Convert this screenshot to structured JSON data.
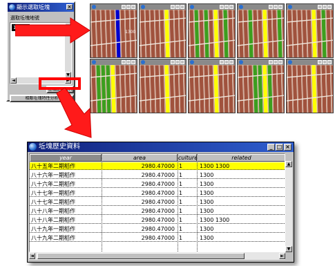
{
  "small_window": {
    "title": "顯示選取坵塊",
    "label": "選取坵塊地號",
    "selected_item": "1300",
    "history_button": "坵塊歷史資料",
    "advanced_button": "相鄰坵塊特性分析"
  },
  "map_grid": {
    "selected_parcel_label": "1300",
    "colors": {
      "paddy": "#a0523d",
      "fallow": "#3c9e1e",
      "selected": "#ffff00",
      "query": "#0000cc"
    }
  },
  "history_window": {
    "title": "坵塊歷史資料",
    "columns": [
      "year",
      "area",
      "culture",
      "related"
    ],
    "rows": [
      {
        "year": "八十五年二期稻作",
        "area": "2980.47000",
        "culture": "1",
        "related": "1300 1300"
      },
      {
        "year": "八十六年一期稻作",
        "area": "2980.47000",
        "culture": "1",
        "related": "1300"
      },
      {
        "year": "八十六年二期稻作",
        "area": "2980.47000",
        "culture": "1",
        "related": "1300"
      },
      {
        "year": "八十七年一期稻作",
        "area": "2980.47000",
        "culture": "1",
        "related": "1300"
      },
      {
        "year": "八十七年二期稻作",
        "area": "2980.47000",
        "culture": "1",
        "related": "1300"
      },
      {
        "year": "八十八年一期稻作",
        "area": "2980.47000",
        "culture": "1",
        "related": "1300"
      },
      {
        "year": "八十八年二期稻作",
        "area": "2980.47000",
        "culture": "1",
        "related": "1300 1300"
      },
      {
        "year": "八十九年一期稻作",
        "area": "2980.47000",
        "culture": "1",
        "related": "1300"
      },
      {
        "year": "八十九年二期稻作",
        "area": "2980.47000",
        "culture": "1",
        "related": "1300"
      }
    ],
    "selected_row": 0
  }
}
